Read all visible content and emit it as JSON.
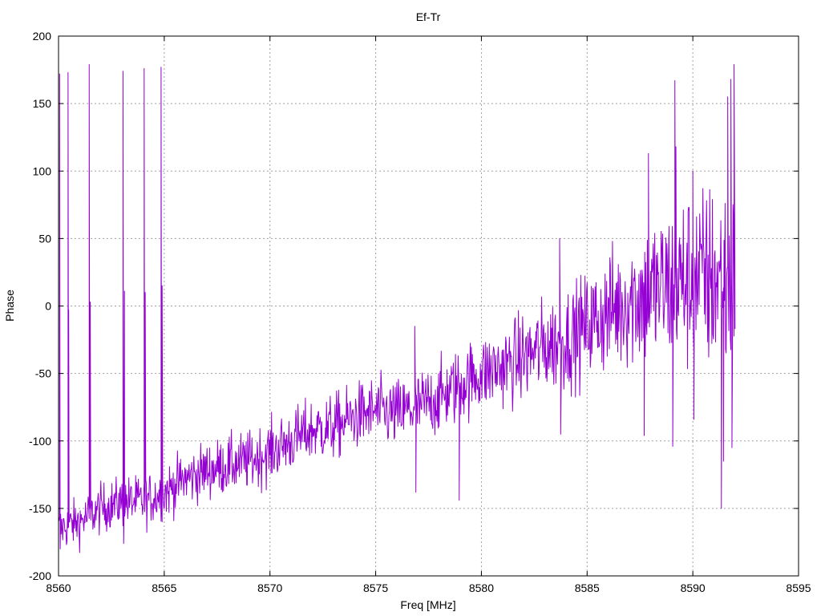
{
  "chart_data": {
    "type": "line",
    "title": "Ef-Tr",
    "xlabel": "Freq [MHz]",
    "ylabel": "Phase",
    "xlim": [
      8560,
      8595
    ],
    "ylim": [
      -200,
      200
    ],
    "xticks": [
      8560,
      8565,
      8570,
      8575,
      8580,
      8585,
      8590,
      8595
    ],
    "yticks": [
      -200,
      -150,
      -100,
      -50,
      0,
      50,
      100,
      150,
      200
    ],
    "grid": true,
    "series": [
      {
        "color": "#9400d3",
        "points_per_MHz": 40,
        "x_start": 8560.0,
        "x_end": 8592.0,
        "trend_anchors": [
          [
            8560.0,
            -165
          ],
          [
            8561.0,
            -160
          ],
          [
            8562.0,
            -150
          ],
          [
            8563.0,
            -145
          ],
          [
            8564.0,
            -145
          ],
          [
            8565.0,
            -138
          ],
          [
            8566.0,
            -128
          ],
          [
            8567.0,
            -122
          ],
          [
            8568.0,
            -118
          ],
          [
            8569.0,
            -115
          ],
          [
            8570.0,
            -108
          ],
          [
            8571.0,
            -100
          ],
          [
            8572.0,
            -92
          ],
          [
            8573.0,
            -90
          ],
          [
            8574.0,
            -82
          ],
          [
            8575.0,
            -78
          ],
          [
            8576.0,
            -80
          ],
          [
            8577.0,
            -75
          ],
          [
            8578.0,
            -68
          ],
          [
            8579.0,
            -58
          ],
          [
            8580.0,
            -50
          ],
          [
            8581.0,
            -45
          ],
          [
            8582.0,
            -38
          ],
          [
            8583.0,
            -30
          ],
          [
            8584.0,
            -25
          ],
          [
            8585.0,
            -15
          ],
          [
            8586.0,
            -5
          ],
          [
            8587.0,
            5
          ],
          [
            8588.0,
            10
          ],
          [
            8589.0,
            15
          ],
          [
            8590.0,
            20
          ],
          [
            8591.0,
            20
          ],
          [
            8592.0,
            15
          ]
        ],
        "noise_anchors": [
          [
            8560.0,
            12
          ],
          [
            8565.0,
            14
          ],
          [
            8570.0,
            16
          ],
          [
            8575.0,
            18
          ],
          [
            8580.0,
            20
          ],
          [
            8585.0,
            28
          ],
          [
            8588.0,
            40
          ],
          [
            8590.0,
            48
          ],
          [
            8592.0,
            55
          ]
        ],
        "spikes": [
          [
            8560.05,
            172
          ],
          [
            8560.08,
            -180
          ],
          [
            8560.45,
            173
          ],
          [
            8560.48,
            -3
          ],
          [
            8561.45,
            179
          ],
          [
            8561.5,
            3
          ],
          [
            8563.05,
            174
          ],
          [
            8563.08,
            -176
          ],
          [
            8563.12,
            11
          ],
          [
            8564.05,
            176
          ],
          [
            8564.1,
            10
          ],
          [
            8564.85,
            177
          ],
          [
            8564.9,
            15
          ],
          [
            8576.85,
            -15
          ],
          [
            8576.9,
            -138
          ],
          [
            8578.95,
            -144
          ],
          [
            8583.7,
            50
          ],
          [
            8583.75,
            -95
          ],
          [
            8587.9,
            113
          ],
          [
            8587.7,
            -96
          ],
          [
            8589.15,
            167
          ],
          [
            8589.2,
            118
          ],
          [
            8589.05,
            -104
          ],
          [
            8590.0,
            100
          ],
          [
            8590.05,
            -84
          ],
          [
            8591.35,
            -150
          ],
          [
            8591.45,
            -115
          ],
          [
            8591.65,
            155
          ],
          [
            8591.8,
            168
          ],
          [
            8591.85,
            -105
          ],
          [
            8591.95,
            179
          ],
          [
            8591.98,
            68
          ]
        ]
      }
    ]
  }
}
